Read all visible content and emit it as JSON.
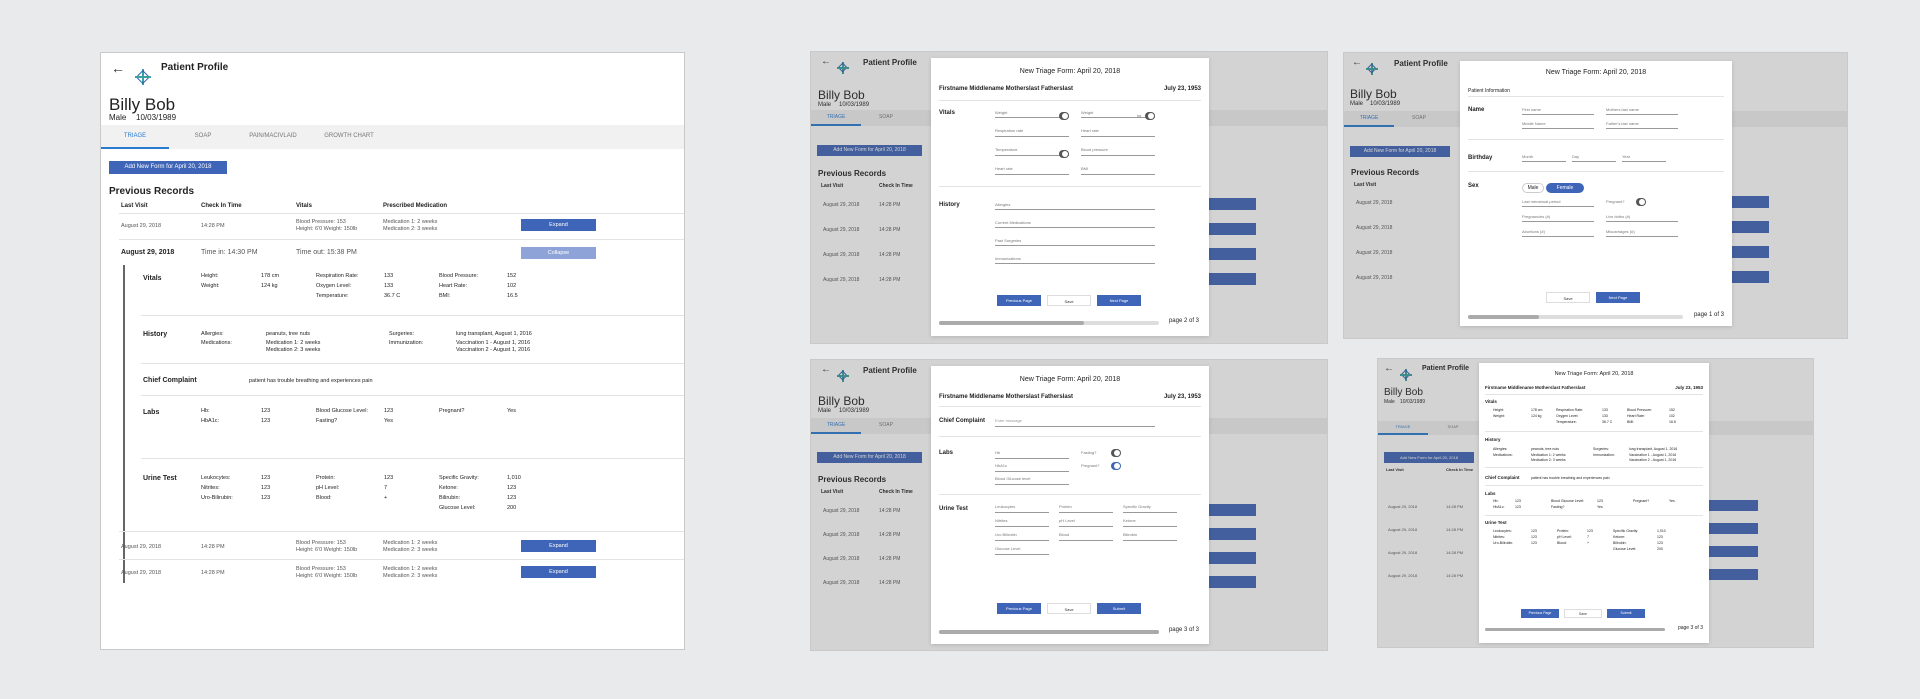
{
  "header": {
    "title": "Patient Profile"
  },
  "patient": {
    "name": "Billy Bob",
    "sex": "Male",
    "dob": "10/03/1989"
  },
  "tabs": [
    "TRIAGE",
    "SOAP",
    "PAIN/MACIVLAID",
    "GROWTH CHART"
  ],
  "add_form_label": "Add New Form for April 20, 2018",
  "records": {
    "title": "Previous Records",
    "headers": [
      "Last Visit",
      "Check In Time",
      "Vitals",
      "Prescribed Medication"
    ],
    "rows": [
      {
        "date": "August 29, 2018",
        "time": "14:28 PM",
        "vitals1": "Blood Pressure: 153",
        "vitals2": "Height: 6'0 Weight: 150lb",
        "med1": "Medication 1: 2 weeks",
        "med2": "Medication 2: 3 weeks",
        "action": "Expand"
      },
      {
        "date": "August 29, 2018",
        "time": "14:28 PM",
        "vitals1": "Blood Pressure: 153",
        "vitals2": "Height: 6'0 Weight: 150lb",
        "med1": "Medication 1: 2 weeks",
        "med2": "Medication 2: 3 weeks",
        "action": "Expand"
      },
      {
        "date": "August 29, 2018",
        "time": "14:28 PM",
        "vitals1": "Blood Pressure: 153",
        "vitals2": "Height: 6'0 Weight: 150lb",
        "med1": "Medication 1: 2 weeks",
        "med2": "Medication 2: 3 weeks",
        "action": "Expand"
      }
    ]
  },
  "expanded": {
    "date": "August 29, 2018",
    "time_in": "Time in: 14:30 PM",
    "time_out": "Time out: 15:38 PM",
    "collapse_label": "Collapse",
    "vitals": {
      "label": "Vitals",
      "cells": [
        "Height:",
        "178 cm",
        "Respiration Rate:",
        "133",
        "Blood Pressure:",
        "152",
        "Weight:",
        "124 kg",
        "Oxygen Level:",
        "133",
        "Heart Rate:",
        "102",
        "",
        "",
        "Temperature:",
        "36.7 C",
        "BMI:",
        "16.5"
      ]
    },
    "history": {
      "label": "History",
      "allergies_label": "Allergies:",
      "allergies": "peanuts, tree nuts",
      "medications_label": "Medications:",
      "med1": "Medication 1: 2 weeks",
      "med2": "Medication 2: 3 weeks",
      "surgeries_label": "Surgeries:",
      "surgeries": "lung transplant, August 1, 2016",
      "immunization_label": "Immunization:",
      "vacc1": "Vaccination 1 - August 1, 2016",
      "vacc2": "Vaccination 2 - August 1, 2016"
    },
    "chief": {
      "label": "Chief Complaint",
      "text": "patient has trouble breathing and experiences pain"
    },
    "labs": {
      "label": "Labs",
      "cells": [
        "Hb:",
        "123",
        "Blood Glucose Level:",
        "123",
        "Pregnant?",
        "Yes",
        "HbA1c:",
        "123",
        "Fasting?",
        "Yes",
        "",
        ""
      ]
    },
    "urine": {
      "label": "Urine Test",
      "cells": [
        "Leukocytes:",
        "123",
        "Protein:",
        "123",
        "Specific Gravity:",
        "1,010",
        "Nitrites:",
        "123",
        "pH Level:",
        "7",
        "Ketone:",
        "123",
        "Uro-Bilirubin:",
        "123",
        "Blood:",
        "+",
        "Bilirubin:",
        "123",
        "",
        "",
        "",
        "",
        "Glucose Level:",
        "200"
      ]
    }
  },
  "form_title": "New Triage Form: April 20, 2018",
  "form_patient_full": "Firstname Middlename Motherslast Fatherslast",
  "form_patient_short": "Firstname Middlename Motherslast Fatherslast",
  "form_dob": "July 23, 1953",
  "form2": {
    "vitals_label": "Vitals",
    "weight": "Weight",
    "kg": "kg",
    "resp": "Respiration rate",
    "heart": "Heart rate",
    "temp": "Temperature",
    "bp": "Blood pressure",
    "bmi": "BMI",
    "history_label": "History",
    "allergies": "Allergies",
    "current_meds": "Current Medications",
    "past_surgeries": "Past Surgeries",
    "immunizations": "Immunizations",
    "unit": "unit",
    "prev": "Previous Page",
    "save": "Save",
    "next": "Next Page",
    "page": "page 2 of 3"
  },
  "form1": {
    "section": "Patient Information",
    "name": "Name",
    "first": "First name",
    "mother": "Mothers last name",
    "middle": "Middle Name",
    "father": "Father's last name",
    "birthday": "Birthday",
    "month": "Month",
    "day": "Day",
    "year": "Year",
    "sex": "Sex",
    "male": "Male",
    "female": "Female",
    "lmp": "Last menstrual period",
    "pregnant": "Pregnant?",
    "pregnancies": "Pregnancies (#)",
    "live_births": "Live births (#)",
    "abortions": "Abortions (#)",
    "miscarriages": "Miscarriages (#)",
    "save": "Save",
    "next": "Next Page",
    "page": "page 1 of 3"
  },
  "form3": {
    "chief_label": "Chief Complaint",
    "chief_placeholder": "Enter message",
    "labs_label": "Labs",
    "hb": "Hb",
    "hba1c": "HbA1c",
    "bgl": "Blood Glucose level",
    "fasting": "Fasting?",
    "pregnant": "Pregnant?",
    "urine_label": "Urine Test",
    "leuk": "Leukocytes",
    "protein": "Protein",
    "sg": "Specific Gravity",
    "nitrites": "Nitrites",
    "ph": "pH Level",
    "ketone": "Ketone",
    "uro": "Uro Bilirubin",
    "blood": "Blood",
    "bili": "Bilirubin",
    "glucose": "Glucose Level",
    "prev": "Previous Page",
    "save": "Save",
    "submit": "Submit",
    "page": "page 3 of 3"
  },
  "review": {
    "vitals_label": "Vitals",
    "history_label": "History",
    "chief_label": "Chief Complaint",
    "labs_label": "Labs",
    "urine_label": "Urine Test",
    "prev": "Previous Page",
    "save": "Save",
    "submit": "Submit",
    "page": "page 3 of 3"
  }
}
